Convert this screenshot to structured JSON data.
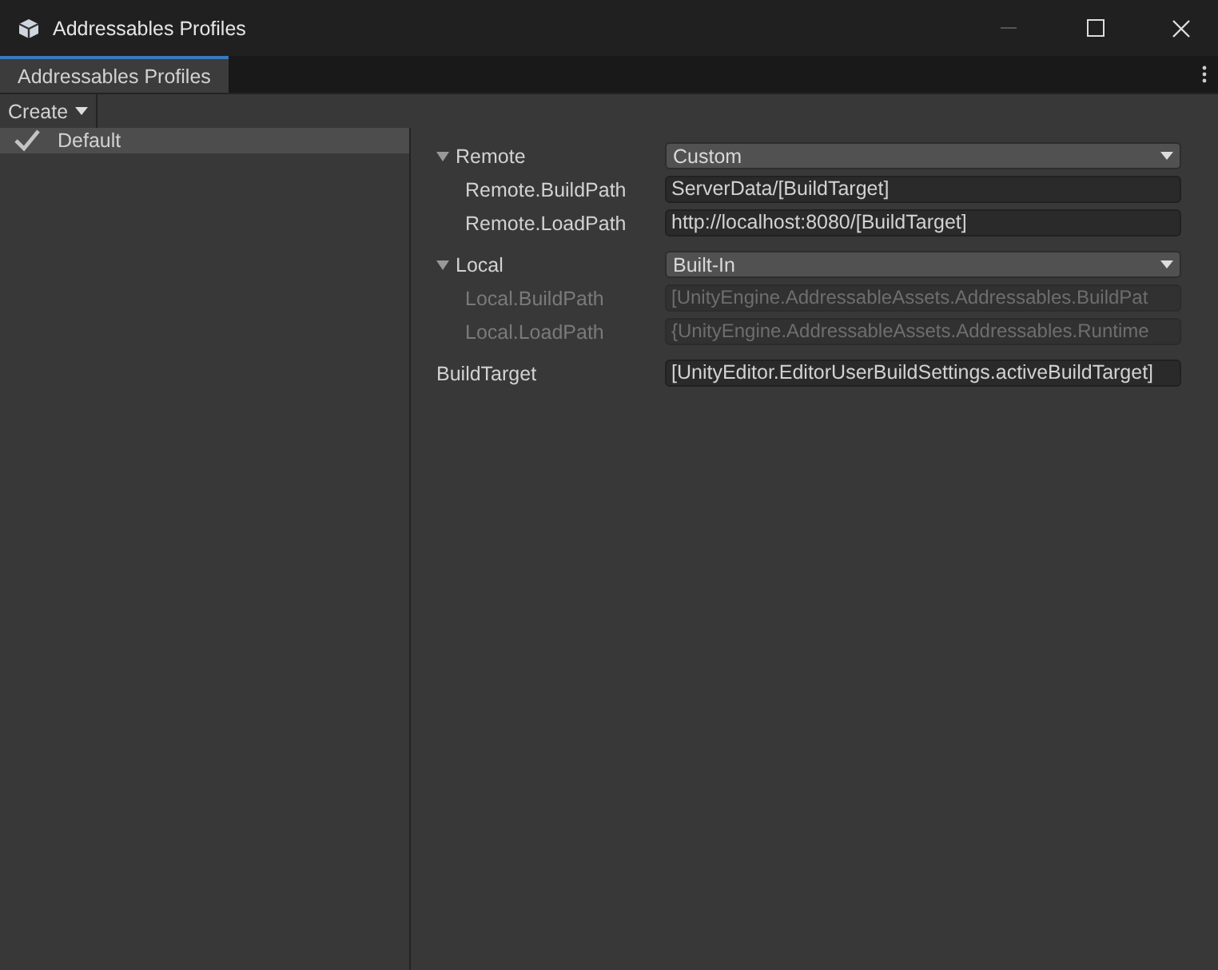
{
  "window": {
    "title": "Addressables Profiles"
  },
  "tabs": [
    {
      "label": "Addressables Profiles",
      "selected": true
    }
  ],
  "toolbar": {
    "create_menu": "Create"
  },
  "profiles": [
    {
      "name": "Default",
      "selected": true,
      "checked": true
    }
  ],
  "groups": [
    {
      "name": "Remote",
      "expanded": true,
      "mode": "Custom",
      "fields": [
        {
          "label": "Remote.BuildPath",
          "value": "ServerData/[BuildTarget]",
          "disabled": false
        },
        {
          "label": "Remote.LoadPath",
          "value": "http://localhost:8080/[BuildTarget]",
          "disabled": false
        }
      ]
    },
    {
      "name": "Local",
      "expanded": true,
      "mode": "Built-In",
      "fields": [
        {
          "label": "Local.BuildPath",
          "value": "[UnityEngine.AddressableAssets.Addressables.BuildPat",
          "disabled": true
        },
        {
          "label": "Local.LoadPath",
          "value": "{UnityEngine.AddressableAssets.Addressables.Runtime",
          "disabled": true
        }
      ]
    }
  ],
  "variables": [
    {
      "label": "BuildTarget",
      "value": "[UnityEditor.EditorUserBuildSettings.activeBuildTarget]",
      "disabled": false
    }
  ]
}
